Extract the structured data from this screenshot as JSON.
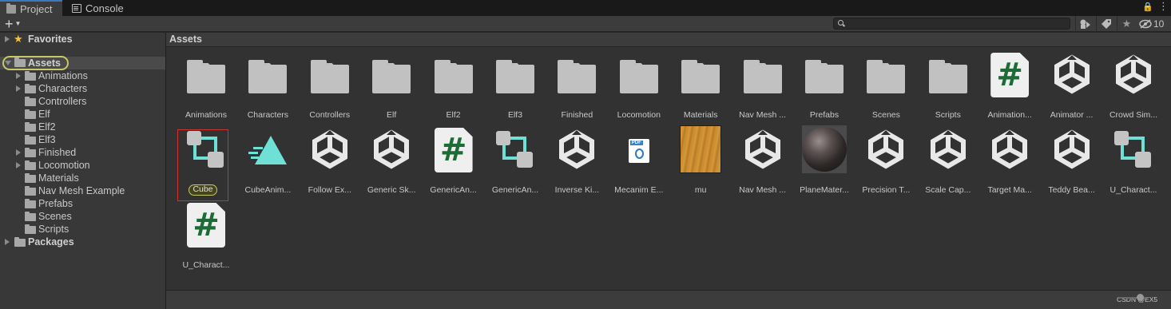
{
  "tabs": [
    {
      "label": "Project",
      "icon": "folder-icon",
      "active": true
    },
    {
      "label": "Console",
      "icon": "console-icon",
      "active": false
    }
  ],
  "toolbar": {
    "search_placeholder": "",
    "hidden_count": "10"
  },
  "tree": {
    "favorites": "Favorites",
    "assets": "Assets",
    "children": [
      "Animations",
      "Characters",
      "Controllers",
      "Elf",
      "Elf2",
      "Elf3",
      "Finished",
      "Locomotion",
      "Materials",
      "Nav Mesh Example",
      "Prefabs",
      "Scenes",
      "Scripts"
    ],
    "packages": "Packages"
  },
  "breadcrumb": "Assets",
  "items": [
    {
      "name": "Animations",
      "type": "folder"
    },
    {
      "name": "Characters",
      "type": "folder"
    },
    {
      "name": "Controllers",
      "type": "folder"
    },
    {
      "name": "Elf",
      "type": "folder"
    },
    {
      "name": "Elf2",
      "type": "folder"
    },
    {
      "name": "Elf3",
      "type": "folder"
    },
    {
      "name": "Finished",
      "type": "folder"
    },
    {
      "name": "Locomotion",
      "type": "folder"
    },
    {
      "name": "Materials",
      "type": "folder"
    },
    {
      "name": "Nav Mesh ...",
      "type": "folder"
    },
    {
      "name": "Prefabs",
      "type": "folder"
    },
    {
      "name": "Scenes",
      "type": "folder"
    },
    {
      "name": "Scripts",
      "type": "folder"
    },
    {
      "name": "Animation...",
      "type": "script"
    },
    {
      "name": "Animator ...",
      "type": "unity"
    },
    {
      "name": "Crowd Sim...",
      "type": "unity"
    },
    {
      "name": "Cube",
      "type": "controller",
      "selected": true
    },
    {
      "name": "CubeAnim...",
      "type": "anim"
    },
    {
      "name": "Follow Ex...",
      "type": "unity"
    },
    {
      "name": "Generic Sk...",
      "type": "unity"
    },
    {
      "name": "GenericAn...",
      "type": "script"
    },
    {
      "name": "GenericAn...",
      "type": "controller"
    },
    {
      "name": "Inverse Ki...",
      "type": "unity"
    },
    {
      "name": "Mecanim E...",
      "type": "pdf"
    },
    {
      "name": "mu",
      "type": "texture"
    },
    {
      "name": "Nav Mesh ...",
      "type": "unity"
    },
    {
      "name": "PlaneMater...",
      "type": "material"
    },
    {
      "name": "Precision T...",
      "type": "unity"
    },
    {
      "name": "Scale Cap...",
      "type": "unity"
    },
    {
      "name": "Target Ma...",
      "type": "unity"
    },
    {
      "name": "Teddy Bea...",
      "type": "unity"
    },
    {
      "name": "U_Charact...",
      "type": "controller"
    },
    {
      "name": "U_Charact...",
      "type": "script"
    }
  ],
  "status": {
    "watermark": "CSDN @EX5"
  },
  "colors": {
    "accent_teal": "#6fe0d6",
    "selection_ring": "#c8c866",
    "selection_border": "#d03030",
    "star": "#f4c33a"
  }
}
